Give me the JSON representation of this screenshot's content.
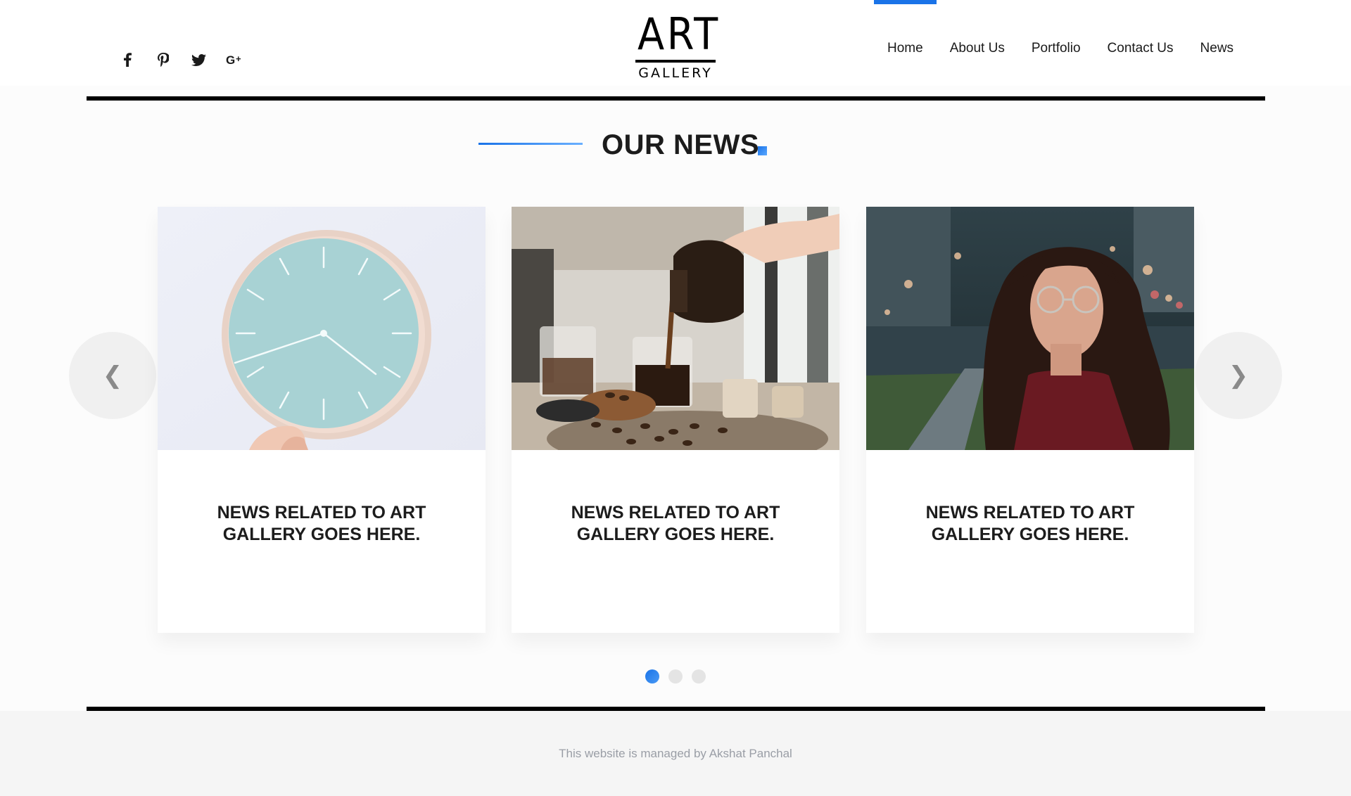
{
  "header": {
    "logo": {
      "line1": "ART",
      "line2": "GALLERY"
    },
    "social": [
      {
        "icon": "facebook-icon"
      },
      {
        "icon": "pinterest-icon"
      },
      {
        "icon": "twitter-icon"
      },
      {
        "icon": "google-plus-icon"
      }
    ],
    "nav": [
      {
        "label": "Home",
        "active": true
      },
      {
        "label": "About Us"
      },
      {
        "label": "Portfolio"
      },
      {
        "label": "Contact Us"
      },
      {
        "label": "News"
      }
    ]
  },
  "main": {
    "section_title": "OUR NEWS",
    "cards": [
      {
        "image": "wall-clock-photo",
        "title": "NEWS RELATED TO ART GALLERY GOES HERE."
      },
      {
        "image": "coffee-pour-photo",
        "title": "NEWS RELATED TO ART GALLERY GOES HERE."
      },
      {
        "image": "woman-portrait-photo",
        "title": "NEWS RELATED TO ART GALLERY GOES HERE."
      }
    ],
    "carousel": {
      "prev_glyph": "❮",
      "next_glyph": "❯",
      "page_count": 3,
      "active_page": 1
    }
  },
  "footer": {
    "text": "This website is managed by Akshat Panchal"
  },
  "colors": {
    "accent": "#1a73e8",
    "rule": "#000000",
    "footer_bg": "#f5f5f5",
    "footer_text": "#9a9ea6"
  }
}
